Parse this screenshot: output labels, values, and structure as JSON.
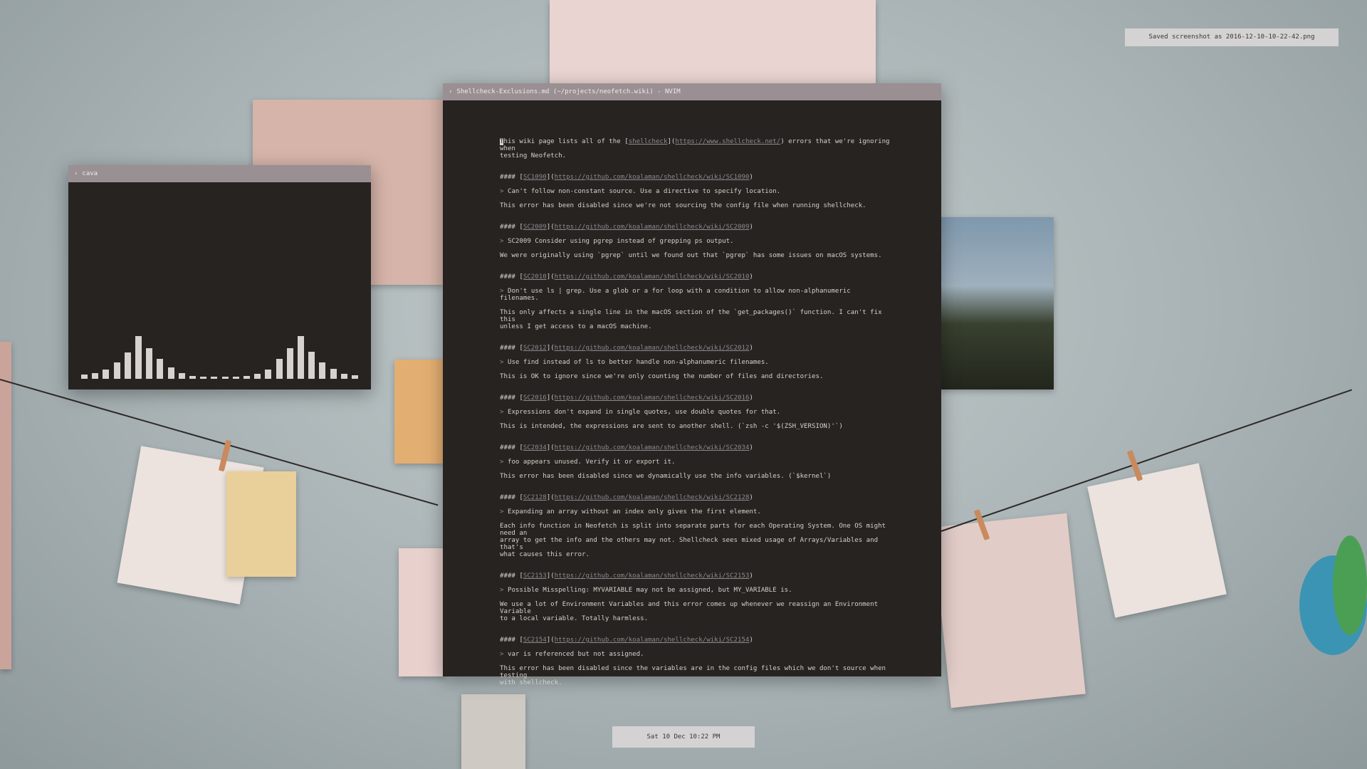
{
  "colors": {
    "window_bg": "#262321",
    "titlebar": "#9a8f92",
    "text": "#d7d1cb",
    "link": "#8c8a8c",
    "notification_bg": "#d5d2d3"
  },
  "notification": {
    "text": "Saved screenshot as 2016-12-10-10-22-42.png"
  },
  "clock": {
    "text": "Sat 10 Dec 10:22 PM"
  },
  "cava_window": {
    "title_icon": "chevron-right-icon",
    "title": "cava",
    "bar_levels": [
      0.1,
      0.14,
      0.22,
      0.38,
      0.62,
      1.0,
      0.72,
      0.46,
      0.26,
      0.14,
      0.06,
      0.04,
      0.04,
      0.04,
      0.04,
      0.06,
      0.12,
      0.22,
      0.46,
      0.72,
      1.0,
      0.64,
      0.38,
      0.24,
      0.12,
      0.08
    ]
  },
  "nvim_window": {
    "title_icon": "chevron-right-icon",
    "title": "Shellcheck-Exclusions.md (~/projects/neofetch.wiki) - NVIM",
    "intro": {
      "cursor_char": "T",
      "text_before": "his wiki page lists all of the [",
      "link_text": "shellcheck",
      "mid": "](",
      "link_url": "https://www.shellcheck.net/",
      "text_after": ") errors that we're ignoring when",
      "line2": "testing Neofetch."
    },
    "entries": [
      {
        "heading_prefix": "#### [",
        "code": "SC1090",
        "url": "https://github.com/koalaman/shellcheck/wiki/SC1090",
        "quote_mark": ">",
        "quote": "Can't follow non-constant source. Use a directive to specify location.",
        "note": "This error has been disabled since we're not sourcing the config file when running shellcheck."
      },
      {
        "heading_prefix": "#### [",
        "code": "SC2009",
        "url": "https://github.com/koalaman/shellcheck/wiki/SC2009",
        "quote_mark": ">",
        "quote": "SC2009 Consider using pgrep instead of grepping ps output.",
        "note": "We were originally using `pgrep` until we found out that `pgrep` has some issues on macOS systems."
      },
      {
        "heading_prefix": "#### [",
        "code": "SC2010",
        "url": "https://github.com/koalaman/shellcheck/wiki/SC2010",
        "quote_mark": ">",
        "quote": "Don't use ls | grep. Use a glob or a for loop with a condition to allow non-alphanumeric filenames.",
        "note": "This only affects a single line in the macOS section of the `get_packages()` function. I can't fix this\nunless I get access to a macOS machine."
      },
      {
        "heading_prefix": "#### [",
        "code": "SC2012",
        "url": "https://github.com/koalaman/shellcheck/wiki/SC2012",
        "quote_mark": ">",
        "quote": "Use find instead of ls to better handle non-alphanumeric filenames.",
        "note": "This is OK to ignore since we're only counting the number of files and directories."
      },
      {
        "heading_prefix": "#### [",
        "code": "SC2016",
        "url": "https://github.com/koalaman/shellcheck/wiki/SC2016",
        "quote_mark": ">",
        "quote": "Expressions don't expand in single quotes, use double quotes for that.",
        "note": "This is intended, the expressions are sent to another shell. (`zsh -c '$(ZSH_VERSION)'`)"
      },
      {
        "heading_prefix": "#### [",
        "code": "SC2034",
        "url": "https://github.com/koalaman/shellcheck/wiki/SC2034",
        "quote_mark": ">",
        "quote": "foo appears unused. Verify it or export it.",
        "note": "This error has been disabled since we dynamically use the info variables. (`$kernel`)"
      },
      {
        "heading_prefix": "#### [",
        "code": "SC2128",
        "url": "https://github.com/koalaman/shellcheck/wiki/SC2128",
        "quote_mark": ">",
        "quote": "Expanding an array without an index only gives the first element.",
        "note": "Each info function in Neofetch is split into separate parts for each Operating System. One OS might need an\narray to get the info and the others may not. Shellcheck sees mixed usage of Arrays/Variables and that's\nwhat causes this error."
      },
      {
        "heading_prefix": "#### [",
        "code": "SC2153",
        "url": "https://github.com/koalaman/shellcheck/wiki/SC2153",
        "quote_mark": ">",
        "quote": "Possible Misspelling: MYVARIABLE may not be assigned, but MY_VARIABLE is.",
        "note": "We use a lot of Environment Variables and this error comes up whenever we reassign an Environment Variable\nto a local variable. Totally harmless."
      },
      {
        "heading_prefix": "#### [",
        "code": "SC2154",
        "url": "https://github.com/koalaman/shellcheck/wiki/SC2154",
        "quote_mark": ">",
        "quote": "var is referenced but not assigned.",
        "note": "This error has been disabled since the variables are in the config files which we don't source when testing\nwith shellcheck."
      }
    ]
  }
}
